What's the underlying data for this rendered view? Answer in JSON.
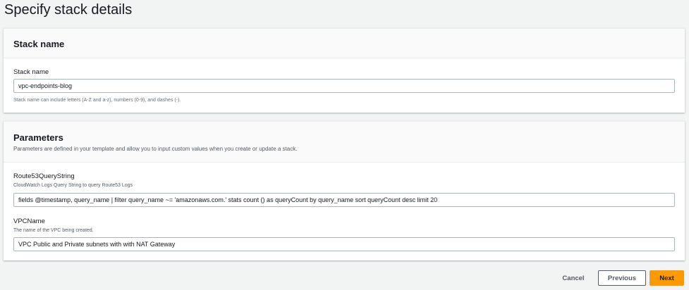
{
  "page_title": "Specify stack details",
  "stack_name_section": {
    "heading": "Stack name",
    "label": "Stack name",
    "value": "vpc-endpoints-blog",
    "hint": "Stack name can include letters (A-Z and a-z), numbers (0-9), and dashes (-)."
  },
  "parameters_section": {
    "heading": "Parameters",
    "description": "Parameters are defined in your template and allow you to input custom values when you create or update a stack.",
    "params": [
      {
        "name": "Route53QueryString",
        "description": "CloudWatch Logs Query String to query Route53 Logs",
        "value": "fields @timestamp, query_name | filter query_name ~= 'amazonaws.com.' stats count () as queryCount by query_name sort queryCount desc limit 20"
      },
      {
        "name": "VPCName",
        "description": "The name of the VPC being created.",
        "value": "VPC Public and Private subnets with with NAT Gateway"
      }
    ]
  },
  "footer": {
    "cancel": "Cancel",
    "previous": "Previous",
    "next": "Next"
  },
  "colors": {
    "primary": "#ff9900"
  }
}
